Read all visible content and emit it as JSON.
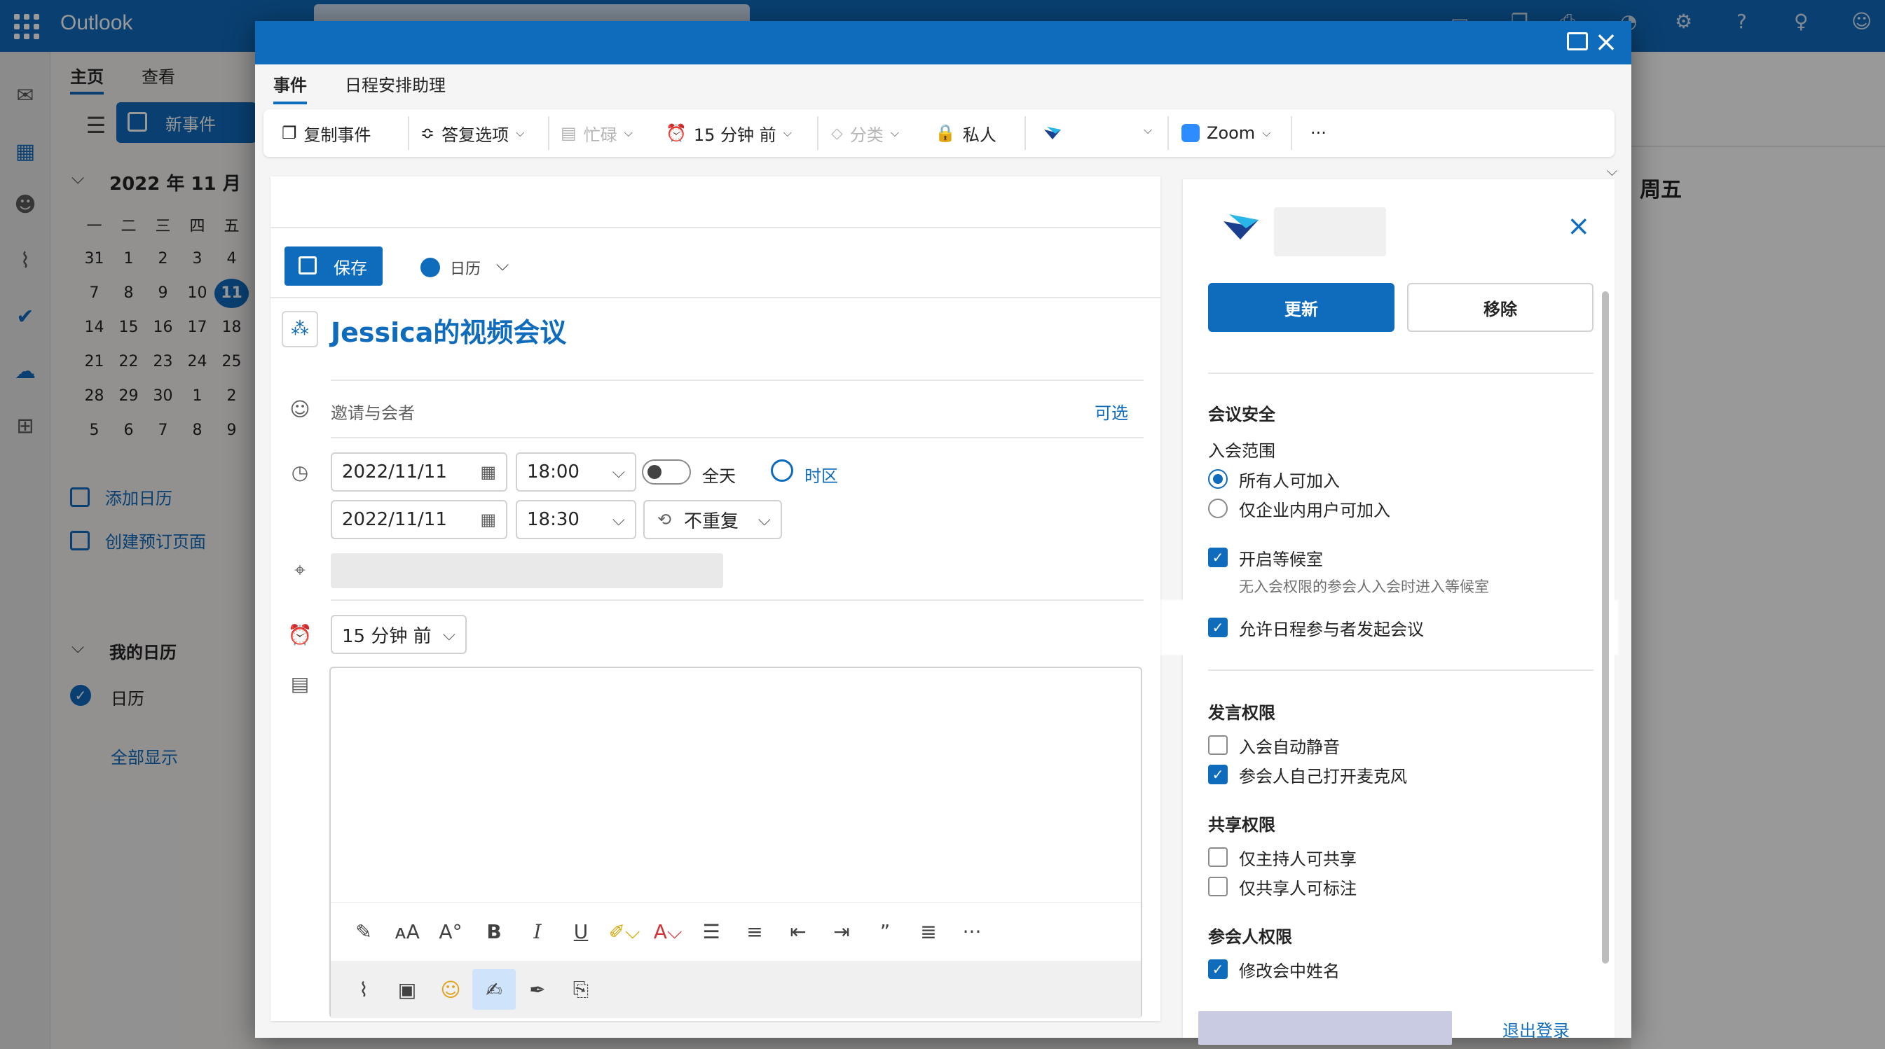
{
  "app": {
    "title": "Outlook"
  },
  "colors": {
    "accent": "#0f6cbd",
    "dim_overlay": "rgba(0,0,0,0.40)"
  },
  "top_icons": [
    "teams-icon",
    "chat-icon",
    "copy-icon",
    "print-icon",
    "bell-icon",
    "gear-icon",
    "help-icon",
    "lightbulb-icon",
    "person-icon"
  ],
  "left_pane": {
    "tabs": [
      "主页",
      "查看"
    ],
    "new_event": "新事件",
    "month_title": "2022 年 11 月",
    "weekdays": [
      "一",
      "二",
      "三",
      "四",
      "五"
    ],
    "weeks": [
      [
        "31",
        "1",
        "2",
        "3",
        "4"
      ],
      [
        "7",
        "8",
        "9",
        "10",
        "11"
      ],
      [
        "14",
        "15",
        "16",
        "17",
        "18"
      ],
      [
        "21",
        "22",
        "23",
        "24",
        "25"
      ],
      [
        "28",
        "29",
        "30",
        "1",
        "2"
      ],
      [
        "5",
        "6",
        "7",
        "8",
        "9"
      ]
    ],
    "today": "11",
    "add_calendar": "添加日历",
    "create_booking": "创建预订页面",
    "my_calendars": "我的日历",
    "calendar_name": "日历",
    "show_all": "全部显示"
  },
  "right_bg": {
    "day_header": "周五"
  },
  "dialog": {
    "tabs": [
      "事件",
      "日程安排助理"
    ],
    "toolbar": {
      "copy_event": "复制事件",
      "reply_options": "答复选项",
      "busy": "忙碌",
      "reminder": "15 分钟 前",
      "categorize": "分类",
      "private": "私人",
      "zoom": "Zoom",
      "more": "···"
    },
    "save": "保存",
    "calendar": "日历",
    "title": "Jessica的视频会议",
    "attendees_placeholder": "邀请与会者",
    "optional": "可选",
    "start_date": "2022/11/11",
    "start_time": "18:00",
    "end_date": "2022/11/11",
    "end_time": "18:30",
    "all_day": "全天",
    "timezone": "时区",
    "repeat": "不重复",
    "reminder": "15 分钟 前"
  },
  "addin": {
    "update": "更新",
    "remove": "移除",
    "security_title": "会议安全",
    "join_scope": "入会范围",
    "join_options": [
      {
        "label": "所有人可加入",
        "selected": true
      },
      {
        "label": "仅企业内用户可加入",
        "selected": false
      }
    ],
    "waiting_room": {
      "label": "开启等候室",
      "checked": true,
      "hint": "无入会权限的参会人入会时进入等候室"
    },
    "allow_start": {
      "label": "允许日程参与者发起会议",
      "checked": true
    },
    "speak_title": "发言权限",
    "speak_options": [
      {
        "label": "入会自动静音",
        "checked": false
      },
      {
        "label": "参会人自己打开麦克风",
        "checked": true
      }
    ],
    "share_title": "共享权限",
    "share_options": [
      {
        "label": "仅主持人可共享",
        "checked": false
      },
      {
        "label": "仅共享人可标注",
        "checked": false
      }
    ],
    "attendee_title": "参会人权限",
    "attendee_options": [
      {
        "label": "修改会中姓名",
        "checked": true
      }
    ],
    "logout": "退出登录"
  }
}
